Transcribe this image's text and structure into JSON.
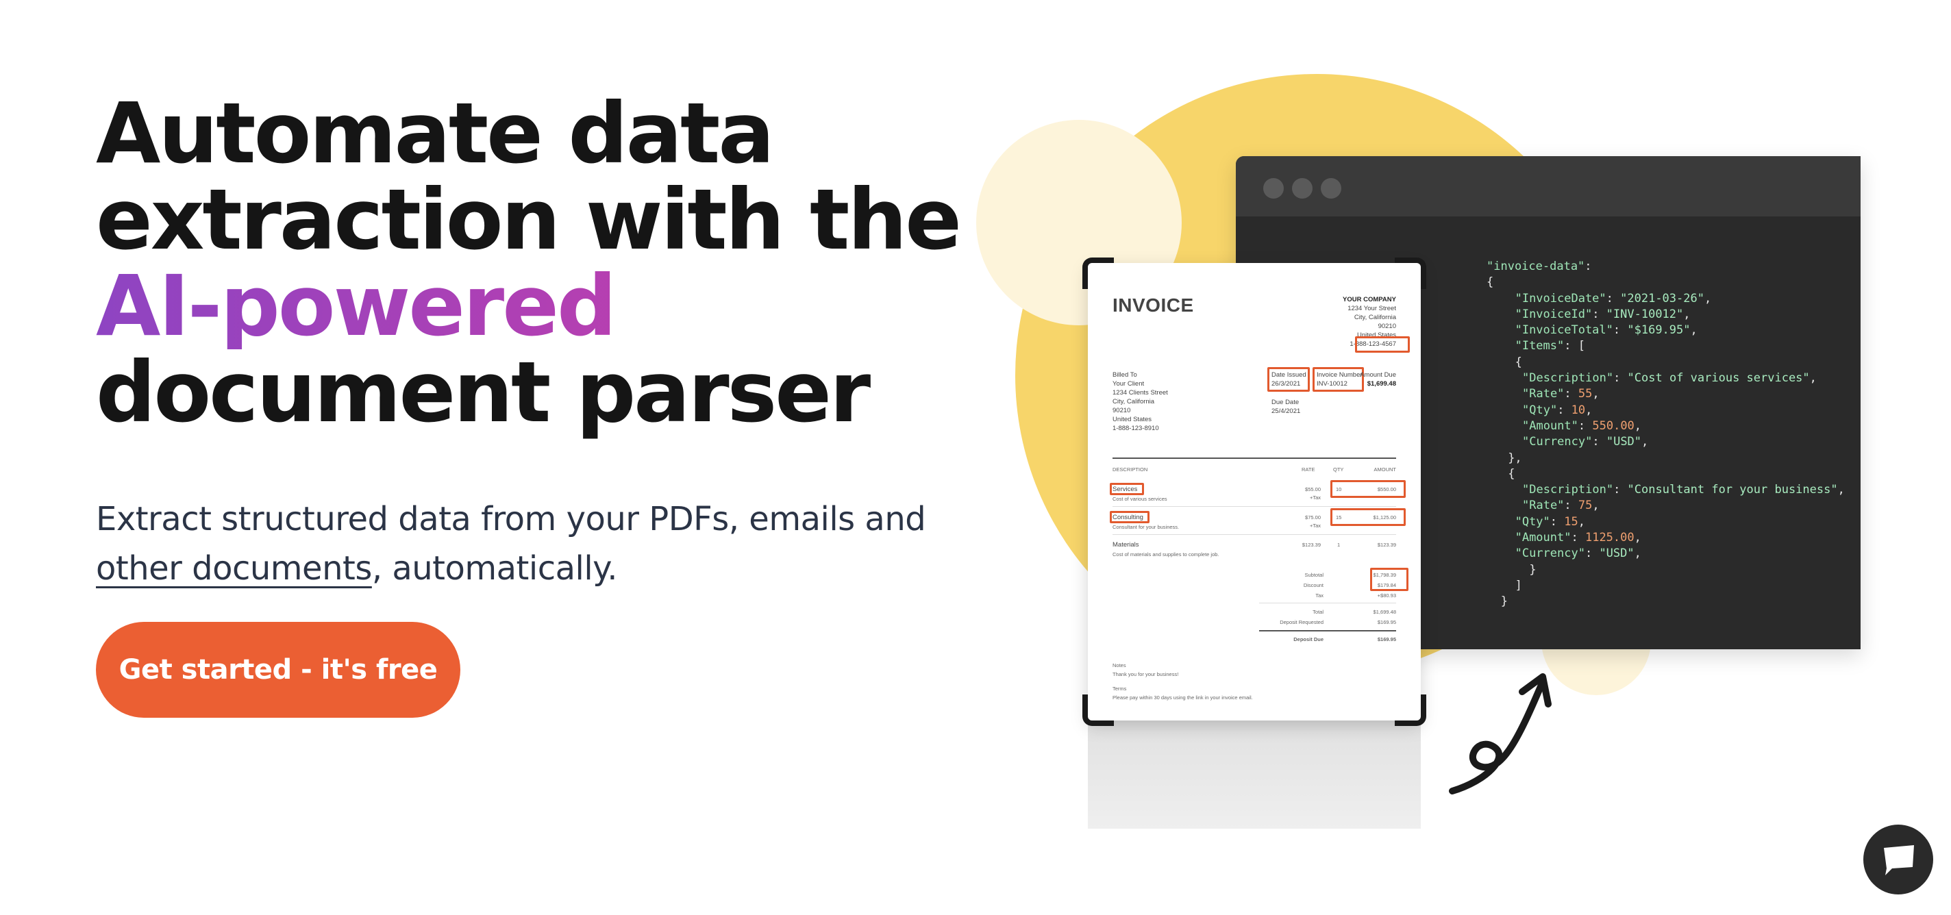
{
  "hero": {
    "title_line1": "Automate data",
    "title_line2": "extraction with the",
    "title_accent": "AI-powered",
    "title_line4": "document parser",
    "subtitle_line1": "Extract structured data from your PDFs, emails and",
    "subtitle_link": "other documents",
    "subtitle_rest": ", automatically.",
    "cta_label": "Get started - it's free"
  },
  "colors": {
    "accent_gradient_start": "#8e44c2",
    "accent_gradient_end": "#c0399f",
    "cta": "#eb5f33",
    "highlight_box": "#e25a2e",
    "blob": "#f7d56a",
    "code_bg": "#2a2a2a"
  },
  "invoice": {
    "title": "INVOICE",
    "company_name": "YOUR COMPANY",
    "company_street": "1234 Your Street",
    "company_city": "City, California",
    "company_zip": "90210",
    "company_country": "United States",
    "company_phone": "1-888-123-4567",
    "billed_to_label": "Billed To",
    "client_name": "Your Client",
    "client_street": "1234 Clients Street",
    "client_city": "City, California",
    "client_zip": "90210",
    "client_country": "United States",
    "client_phone": "1-888-123-8910",
    "date_issued_label": "Date Issued",
    "date_issued": "26/3/2021",
    "invoice_number_label": "Invoice Number",
    "invoice_number": "INV-10012",
    "amount_due_label": "Amount Due",
    "amount_due": "$1,699.48",
    "due_date_label": "Due Date",
    "due_date": "25/4/2021",
    "col_description": "DESCRIPTION",
    "col_rate": "RATE",
    "col_qty": "QTY",
    "col_amount": "AMOUNT",
    "items": [
      {
        "name": "Services",
        "desc": "Cost of various services",
        "rate": "$55.00",
        "tax": "+Tax",
        "qty": "10",
        "amount": "$550.00"
      },
      {
        "name": "Consulting",
        "desc": "Consultant for your business.",
        "rate": "$75.00",
        "tax": "+Tax",
        "qty": "15",
        "amount": "$1,125.00"
      },
      {
        "name": "Materials",
        "desc": "Cost of materials and supplies to complete job.",
        "rate": "$123.39",
        "tax": "",
        "qty": "1",
        "amount": "$123.39"
      }
    ],
    "subtotal_label": "Subtotal",
    "subtotal": "$1,798.39",
    "discount_label": "Discount",
    "discount": "$179.84",
    "tax_label": "Tax",
    "tax": "+$80.93",
    "total_label": "Total",
    "total": "$1,699.48",
    "deposit_requested_label": "Deposit Requested",
    "deposit_requested": "$169.95",
    "deposit_due_label": "Deposit Due",
    "deposit_due": "$169.95",
    "notes_label": "Notes",
    "notes": "Thank you for your business!",
    "terms_label": "Terms",
    "terms": "Please pay within 30 days using the link in your invoice email."
  },
  "code": {
    "lines": [
      {
        "indent": 0,
        "parts": [
          [
            "key",
            "\"invoice-data\""
          ],
          [
            "pun",
            ":"
          ]
        ]
      },
      {
        "indent": 0,
        "parts": [
          [
            "pun",
            "{"
          ]
        ]
      },
      {
        "indent": 4,
        "parts": [
          [
            "key",
            "\"InvoiceDate\""
          ],
          [
            "pun",
            ": "
          ],
          [
            "str",
            "\"2021-03-26\""
          ],
          [
            "pun",
            ","
          ]
        ]
      },
      {
        "indent": 4,
        "parts": [
          [
            "key",
            "\"InvoiceId\""
          ],
          [
            "pun",
            ": "
          ],
          [
            "str",
            "\"INV-10012\""
          ],
          [
            "pun",
            ","
          ]
        ]
      },
      {
        "indent": 4,
        "parts": [
          [
            "key",
            "\"InvoiceTotal\""
          ],
          [
            "pun",
            ": "
          ],
          [
            "str",
            "\"$169.95\""
          ],
          [
            "pun",
            ","
          ]
        ]
      },
      {
        "indent": 4,
        "parts": [
          [
            "key",
            "\"Items\""
          ],
          [
            "pun",
            ": ["
          ]
        ]
      },
      {
        "indent": 4,
        "parts": [
          [
            "pun",
            "{"
          ]
        ]
      },
      {
        "indent": 5,
        "parts": [
          [
            "key",
            "\"Description\""
          ],
          [
            "pun",
            ": "
          ],
          [
            "str",
            "\"Cost of various services\""
          ],
          [
            "pun",
            ","
          ]
        ]
      },
      {
        "indent": 5,
        "parts": [
          [
            "key",
            "\"Rate\""
          ],
          [
            "pun",
            ": "
          ],
          [
            "num",
            "55"
          ],
          [
            "pun",
            ","
          ]
        ]
      },
      {
        "indent": 5,
        "parts": [
          [
            "key",
            "\"Qty\""
          ],
          [
            "pun",
            ": "
          ],
          [
            "num",
            "10"
          ],
          [
            "pun",
            ","
          ]
        ]
      },
      {
        "indent": 5,
        "parts": [
          [
            "key",
            "\"Amount\""
          ],
          [
            "pun",
            ": "
          ],
          [
            "num",
            "550.00"
          ],
          [
            "pun",
            ","
          ]
        ]
      },
      {
        "indent": 5,
        "parts": [
          [
            "key",
            "\"Currency\""
          ],
          [
            "pun",
            ": "
          ],
          [
            "str",
            "\"USD\""
          ],
          [
            "pun",
            ","
          ]
        ]
      },
      {
        "indent": 3,
        "parts": [
          [
            "pun",
            "},"
          ]
        ]
      },
      {
        "indent": 3,
        "parts": [
          [
            "pun",
            "{"
          ]
        ]
      },
      {
        "indent": 5,
        "parts": [
          [
            "key",
            "\"Description\""
          ],
          [
            "pun",
            ": "
          ],
          [
            "str",
            "\"Consultant for your business\""
          ],
          [
            "pun",
            ","
          ]
        ]
      },
      {
        "indent": 5,
        "parts": [
          [
            "key",
            "\"Rate\""
          ],
          [
            "pun",
            ": "
          ],
          [
            "num",
            "75"
          ],
          [
            "pun",
            ","
          ]
        ]
      },
      {
        "indent": 4,
        "parts": [
          [
            "key",
            "\"Qty\""
          ],
          [
            "pun",
            ": "
          ],
          [
            "num",
            "15"
          ],
          [
            "pun",
            ","
          ]
        ]
      },
      {
        "indent": 4,
        "parts": [
          [
            "key",
            "\"Amount\""
          ],
          [
            "pun",
            ": "
          ],
          [
            "num",
            "1125.00"
          ],
          [
            "pun",
            ","
          ]
        ]
      },
      {
        "indent": 4,
        "parts": [
          [
            "key",
            "\"Currency\""
          ],
          [
            "pun",
            ": "
          ],
          [
            "str",
            "\"USD\""
          ],
          [
            "pun",
            ","
          ]
        ]
      },
      {
        "indent": 6,
        "parts": [
          [
            "pun",
            "}"
          ]
        ]
      },
      {
        "indent": 4,
        "parts": [
          [
            "pun",
            "]"
          ]
        ]
      },
      {
        "indent": 2,
        "parts": [
          [
            "pun",
            "}"
          ]
        ]
      }
    ]
  },
  "icons": {
    "window_dots": "window-dot-icon",
    "arrow": "curly-arrow-icon",
    "chat": "chat-bubble-icon"
  }
}
